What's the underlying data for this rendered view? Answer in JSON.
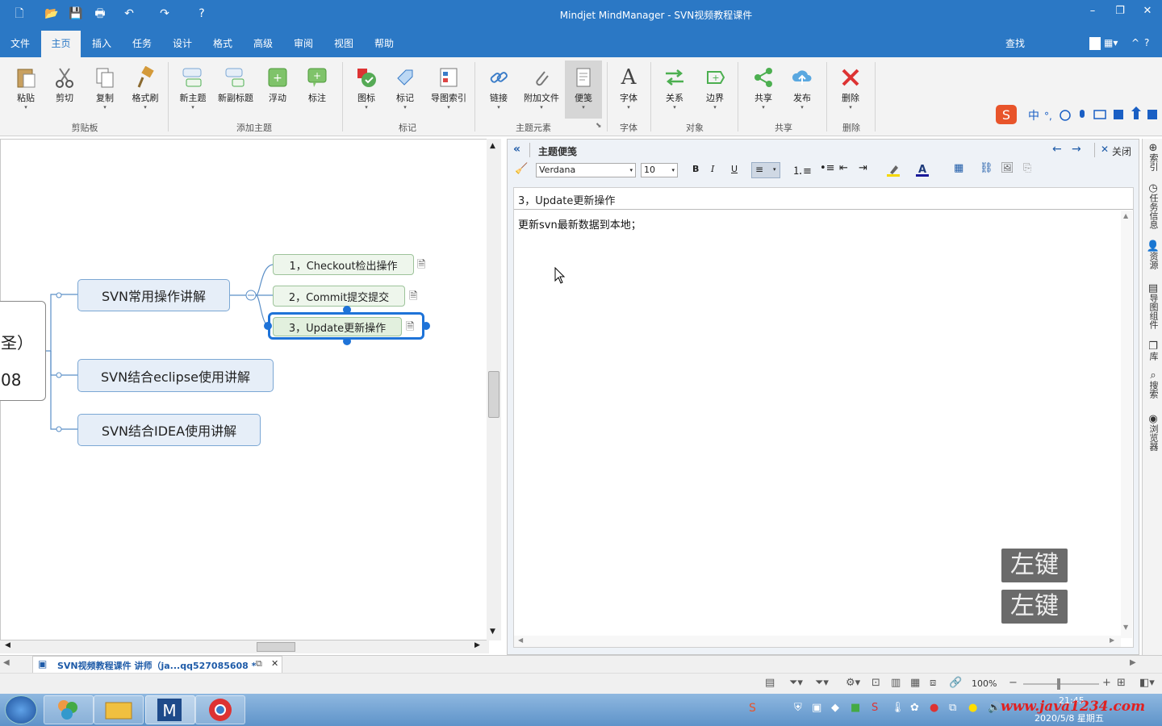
{
  "app": {
    "title": "Mindjet MindManager - SVN视频教程课件"
  },
  "menu": {
    "tabs": [
      "文件",
      "主页",
      "插入",
      "任务",
      "设计",
      "格式",
      "高级",
      "审阅",
      "视图",
      "帮助"
    ],
    "active": "主页",
    "search": "查找"
  },
  "ribbon": {
    "buttons": [
      "粘贴",
      "剪切",
      "复制",
      "格式刷",
      "新主题",
      "新副标题",
      "浮动",
      "标注",
      "图标",
      "标记",
      "导图索引",
      "链接",
      "附加文件",
      "便笺",
      "字体",
      "关系",
      "边界",
      "共享",
      "发布",
      "删除"
    ],
    "groups": [
      "剪贴板",
      "添加主题",
      "标记",
      "主题元素",
      "字体",
      "对象",
      "共享",
      "删除"
    ]
  },
  "map": {
    "central_partial": "圣）",
    "central_partial2": "08",
    "topics": [
      "SVN常用操作讲解",
      "SVN结合eclipse使用讲解",
      "SVN结合IDEA使用讲解"
    ],
    "subtopics": [
      "1，Checkout检出操作",
      "2，Commit提交提交",
      "3，Update更新操作"
    ]
  },
  "notes": {
    "header": "主题便笺",
    "close": "关闭",
    "font": "Verdana",
    "size": "10",
    "topic_title": "3，Update更新操作",
    "body": "更新svn最新数据到本地；",
    "overlay_keys": [
      "左键",
      "左键"
    ]
  },
  "side_strip": [
    "索引",
    "任务信息",
    "资源",
    "导图组件",
    "库",
    "搜索",
    "浏览器"
  ],
  "doc_tab": {
    "label": "SVN视频教程课件 讲师（ja...qq527085608  *"
  },
  "status": {
    "zoom": "100%"
  },
  "taskbar": {
    "clock": "21:45",
    "date": "2020/5/8 星期五",
    "watermark": "www.java1234.com"
  }
}
